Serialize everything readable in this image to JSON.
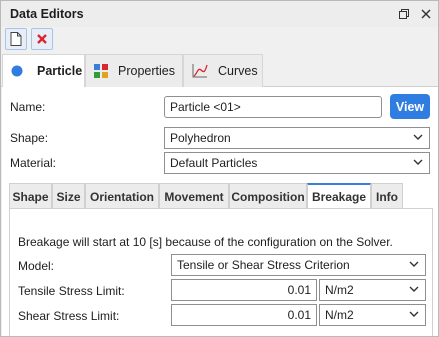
{
  "window": {
    "title": "Data Editors"
  },
  "toolbar": {
    "new_icon": "document-icon",
    "delete_icon": "red-x-icon"
  },
  "main_tabs": [
    {
      "label": "Particle",
      "icon": "blue-circle-icon",
      "active": true
    },
    {
      "label": "Properties",
      "icon": "grid-icon",
      "active": false
    },
    {
      "label": "Curves",
      "icon": "curve-chart-icon",
      "active": false
    }
  ],
  "form": {
    "name_label": "Name:",
    "name_value": "Particle <01>",
    "view_button": "View",
    "shape_label": "Shape:",
    "shape_value": "Polyhedron",
    "material_label": "Material:",
    "material_value": "Default Particles"
  },
  "sub_tabs": [
    {
      "label": "Shape",
      "active": false
    },
    {
      "label": "Size",
      "active": false
    },
    {
      "label": "Orientation",
      "active": false
    },
    {
      "label": "Movement",
      "active": false
    },
    {
      "label": "Composition",
      "active": false
    },
    {
      "label": "Breakage",
      "active": true
    },
    {
      "label": "Info",
      "active": false
    }
  ],
  "breakage": {
    "info_text": "Breakage will start at 10 [s] because of the configuration on the Solver.",
    "model_label": "Model:",
    "model_value": "Tensile or Shear Stress Criterion",
    "tensile_label": "Tensile Stress Limit:",
    "tensile_value": "0.01",
    "tensile_unit": "N/m2",
    "shear_label": "Shear Stress Limit:",
    "shear_value": "0.01",
    "shear_unit": "N/m2"
  },
  "colors": {
    "accent": "#2f7de1",
    "delete": "#d9272e"
  }
}
